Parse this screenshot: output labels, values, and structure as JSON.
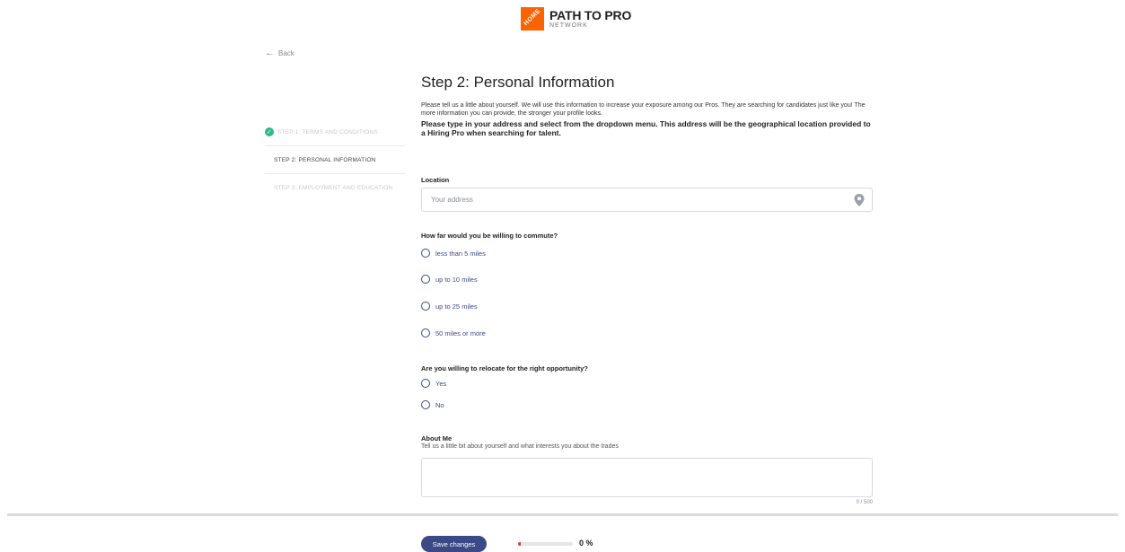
{
  "brand": {
    "title": "PATH TO PRO",
    "subtitle": "NETWORK",
    "mark_text": "HOME"
  },
  "nav": {
    "back_label": "Back"
  },
  "steps": [
    {
      "label": "STEP 1: TERMS AND CONDITIONS",
      "status": "done"
    },
    {
      "label": "STEP 2: PERSONAL INFORMATION",
      "status": "active"
    },
    {
      "label": "STEP 3: EMPLOYMENT AND EDUCATION",
      "status": "pending"
    }
  ],
  "main": {
    "title": "Step 2: Personal Information",
    "intro": "Please tell us a little about yourself. We will use this information to increase your exposure among our Pros. They are searching for candidates just like you! The more information you can provide, the stronger your profile looks.",
    "intro_bold": "Please type in your address and select from the dropdown menu. This address will be the geographical location provided to a Hiring Pro when searching for talent."
  },
  "location": {
    "label": "Location",
    "placeholder": "Your address",
    "value": ""
  },
  "commute": {
    "question": "How far would you be willing to commute?",
    "options": [
      "less than 5 miles",
      "up to 10 miles",
      "up to 25 miles",
      "50 miles or more"
    ]
  },
  "relocate": {
    "question": "Are you willing to relocate for the right opportunity?",
    "options": [
      "Yes",
      "No"
    ]
  },
  "about": {
    "label": "About Me",
    "hint": "Tell us a little bit about yourself and what interests you about the trades",
    "counter": "0 / 500"
  },
  "footer": {
    "save_label": "Save changes",
    "progress_text": "0 %",
    "progress_value": 0.05
  },
  "colors": {
    "primary": "#3b4a86",
    "brand_orange": "#f96302",
    "success": "#2cba84",
    "progress": "#e03a3a"
  }
}
